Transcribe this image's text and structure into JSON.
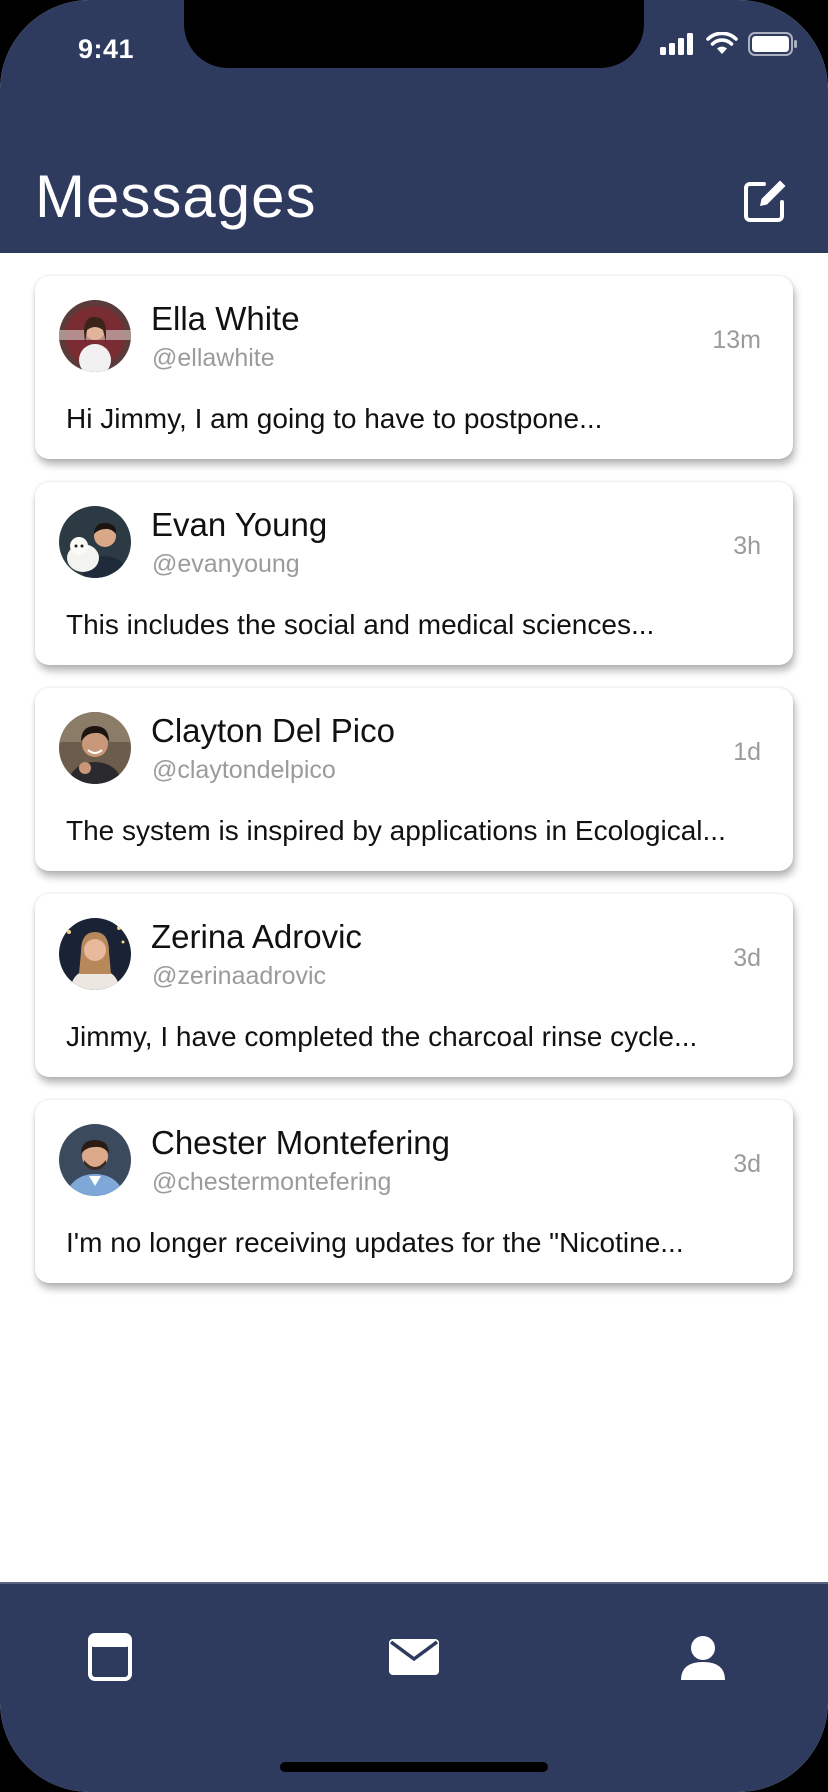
{
  "status_bar": {
    "time": "9:41"
  },
  "header": {
    "title": "Messages"
  },
  "colors": {
    "header_bg": "#2f3a5f",
    "tabbar_bg": "#2f3a5f",
    "secondary_text": "#9b9b9b"
  },
  "icons": {
    "compose": "compose-icon",
    "tabs": [
      "notebook-icon",
      "envelope-icon",
      "person-icon"
    ],
    "status": [
      "cellular-signal-icon",
      "wifi-icon",
      "battery-icon"
    ]
  },
  "messages": [
    {
      "name": "Ella White",
      "handle": "@ellawhite",
      "time": "13m",
      "preview": "Hi Jimmy, I am going to have to postpone..."
    },
    {
      "name": "Evan Young",
      "handle": "@evanyoung",
      "time": "3h",
      "preview": "This includes the social and medical sciences..."
    },
    {
      "name": "Clayton Del Pico",
      "handle": "@claytondelpico",
      "time": "1d",
      "preview": "The system is inspired by applications in Ecological..."
    },
    {
      "name": "Zerina Adrovic",
      "handle": "@zerinaadrovic",
      "time": "3d",
      "preview": "Jimmy, I have completed the charcoal rinse cycle..."
    },
    {
      "name": "Chester Montefering",
      "handle": "@chestermontefering",
      "time": "3d",
      "preview": "I'm no longer receiving updates for the \"Nicotine..."
    }
  ]
}
